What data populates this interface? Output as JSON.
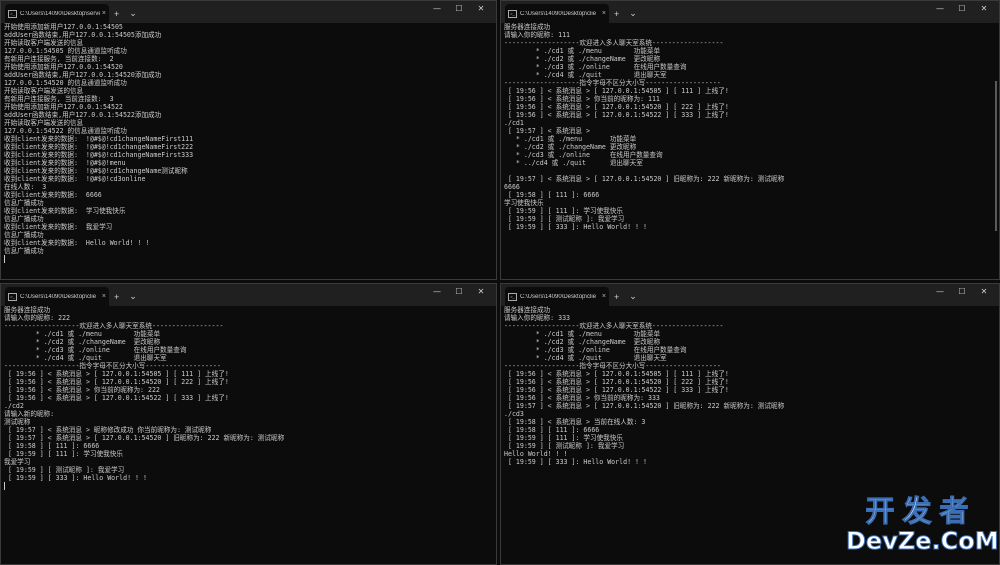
{
  "windows": [
    {
      "id": "server",
      "tab_title": "C:\\Users\\14090\\Desktop\\serve",
      "lines": [
        "开始使用添加新用户127.0.0.1:54505",
        "addUser函数结束,用户127.0.0.1:54505添加成功",
        "开始读取客户端发送的信息",
        "127.0.0.1:54505 的信息通道监听成功",
        "有新用户连接服务, 当前连接数:  2",
        "开始使用添加新用户127.0.0.1:54520",
        "addUser函数结束,用户127.0.0.1:54520添加成功",
        "127.0.0.1:54520 的信息通道监听成功",
        "开始读取客户端发送的信息",
        "有新用户连接服务, 当前连接数:  3",
        "开始使用添加新用户127.0.0.1:54522",
        "addUser函数结束,用户127.0.0.1:54522添加成功",
        "开始读取客户端发送的信息",
        "127.0.0.1:54522 的信息通道监听成功",
        "收到client发来的数据:  !@#$@!cd1changeNameFirst111",
        "收到client发来的数据:  !@#$@!cd1changeNameFirst222",
        "收到client发来的数据:  !@#$@!cd1changeNameFirst333",
        "收到client发来的数据:  !@#$@!menu",
        "收到client发来的数据:  !@#$@!cd1changeName测试昵称",
        "收到client发来的数据:  !@#$@!cd3online",
        "在线人数:  3",
        "收到client发来的数据:  6666",
        "信息广播成功",
        "收到client发来的数据:  学习使我快乐",
        "信息广播成功",
        "收到client发来的数据:  我爱学习",
        "信息广播成功",
        "收到client发来的数据:  Hello World! ! !",
        "信息广播成功"
      ]
    },
    {
      "id": "client-111",
      "tab_title": "C:\\Users\\14090\\Desktop\\clie",
      "lines": [
        "服务器连接成功",
        "请输入你的昵称: 111",
        "-------------------欢迎进入多人聊天室系统------------------",
        "        * ./cd1 或 ./menu        功能菜单",
        "        * ./cd2 或 ./changeName  更改昵称",
        "        * ./cd3 或 ./online      在线用户数量查询",
        "        * ./cd4 或 ./quit        退出聊天室",
        "-------------------指令字母不区分大小写-------------------",
        " [ 19:56 ] < 系统消息 > [ 127.0.0.1:54505 ] [ 111 ] 上线了!",
        " [ 19:56 ] < 系统消息 > 你当前的昵称为: 111",
        " [ 19:56 ] < 系统消息 > [ 127.0.0.1:54520 ] [ 222 ] 上线了!",
        " [ 19:56 ] < 系统消息 > [ 127.0.0.1:54522 ] [ 333 ] 上线了!",
        "./cd1",
        " [ 19:57 ] < 系统消息 >",
        "   * ./cd1 或 ./menu       功能菜单",
        "   * ./cd2 或 ./changeName 更改昵称",
        "   * ./cd3 或 ./online     在线用户数量查询",
        "   * ../cd4 或 ./quit      退出聊天室",
        "",
        " [ 19:57 ] < 系统消息 > [ 127.0.0.1:54520 ] 旧昵称为: 222 新昵称为: 测试昵称",
        "6666",
        " [ 19:58 ] [ 111 ]: 6666",
        "学习使我快乐",
        " [ 19:59 ] [ 111 ]: 学习使我快乐",
        " [ 19:59 ] [ 测试昵称 ]: 我爱学习",
        " [ 19:59 ] [ 333 ]: Hello World! ! !"
      ]
    },
    {
      "id": "client-222",
      "tab_title": "C:\\Users\\14090\\Desktop\\clie",
      "lines": [
        "服务器连接成功",
        "请输入你的昵称: 222",
        "-------------------欢迎进入多人聊天室系统------------------",
        "        * ./cd1 或 ./menu        功能菜单",
        "        * ./cd2 或 ./changeName  更改昵称",
        "        * ./cd3 或 ./online      在线用户数量查询",
        "        * ./cd4 或 ./quit        退出聊天室",
        "-------------------指令字母不区分大小写-------------------",
        " [ 19:56 ] < 系统消息 > [ 127.0.0.1:54505 ] [ 111 ] 上线了!",
        " [ 19:56 ] < 系统消息 > [ 127.0.0.1:54520 ] [ 222 ] 上线了!",
        " [ 19:56 ] < 系统消息 > 你当前的昵称为: 222",
        " [ 19:56 ] < 系统消息 > [ 127.0.0.1:54522 ] [ 333 ] 上线了!",
        "./cd2",
        "请输入新的昵称:",
        "测试昵称",
        " [ 19:57 ] < 系统消息 > 昵称修改成功 你当前昵称为: 测试昵称",
        " [ 19:57 ] < 系统消息 > [ 127.0.0.1:54520 ] 旧昵称为: 222 新昵称为: 测试昵称",
        " [ 19:58 ] [ 111 ]: 6666",
        " [ 19:59 ] [ 111 ]: 学习使我快乐",
        "我爱学习",
        " [ 19:59 ] [ 测试昵称 ]: 我爱学习",
        " [ 19:59 ] [ 333 ]: Hello World! ! !"
      ]
    },
    {
      "id": "client-333",
      "tab_title": "C:\\Users\\14090\\Desktop\\clie",
      "lines": [
        "服务器连接成功",
        "请输入你的昵称: 333",
        "-------------------欢迎进入多人聊天室系统------------------",
        "        * ./cd1 或 ./menu        功能菜单",
        "        * ./cd2 或 ./changeName  更改昵称",
        "        * ./cd3 或 ./online      在线用户数量查询",
        "        * ./cd4 或 ./quit        退出聊天室",
        "-------------------指令字母不区分大小写-------------------",
        " [ 19:56 ] < 系统消息 > [ 127.0.0.1:54505 ] [ 111 ] 上线了!",
        " [ 19:56 ] < 系统消息 > [ 127.0.0.1:54520 ] [ 222 ] 上线了!",
        " [ 19:56 ] < 系统消息 > [ 127.0.0.1:54522 ] [ 333 ] 上线了!",
        " [ 19:56 ] < 系统消息 > 你当前的昵称为: 333",
        " [ 19:57 ] < 系统消息 > [ 127.0.0.1:54520 ] 旧昵称为: 222 新昵称为: 测试昵称",
        "./cd3",
        " [ 19:58 ] < 系统消息 > 当前在线人数: 3",
        " [ 19:58 ] [ 111 ]: 6666",
        " [ 19:59 ] [ 111 ]: 学习使我快乐",
        " [ 19:59 ] [ 测试昵称 ]: 我爱学习",
        "Hello World! ! !",
        " [ 19:59 ] [ 333 ]: Hello World! ! !"
      ]
    }
  ],
  "tab_controls": {
    "close": "×",
    "new_tab": "+",
    "dropdown": "⌄"
  },
  "window_controls": {
    "minimize": "—",
    "maximize": "☐",
    "close": "✕"
  },
  "watermark": {
    "cn": "开发者",
    "en": "DevZe.CoM"
  }
}
